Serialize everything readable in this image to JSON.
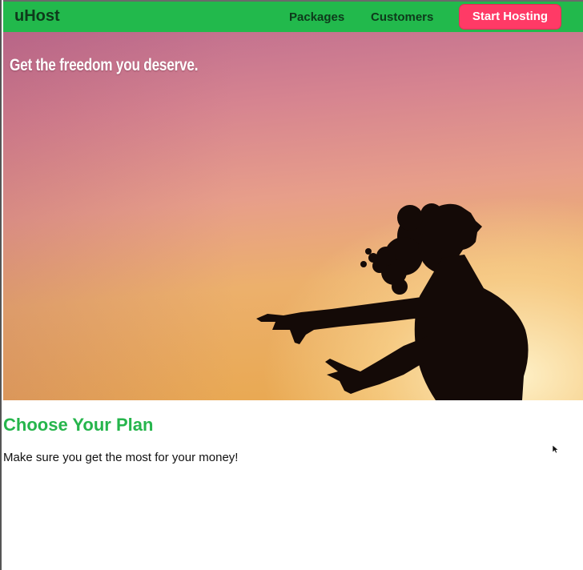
{
  "header": {
    "brand": "uHost",
    "nav": {
      "packages": "Packages",
      "customers": "Customers",
      "cta": "Start Hosting"
    }
  },
  "hero": {
    "title": "Get the freedom you deserve."
  },
  "plans": {
    "heading": "Choose Your Plan",
    "subheading": "Make sure you get the most for your money!"
  },
  "colors": {
    "header_bg": "#22b94c",
    "cta_bg": "#ff3a66",
    "heading_green": "#26b54c"
  }
}
